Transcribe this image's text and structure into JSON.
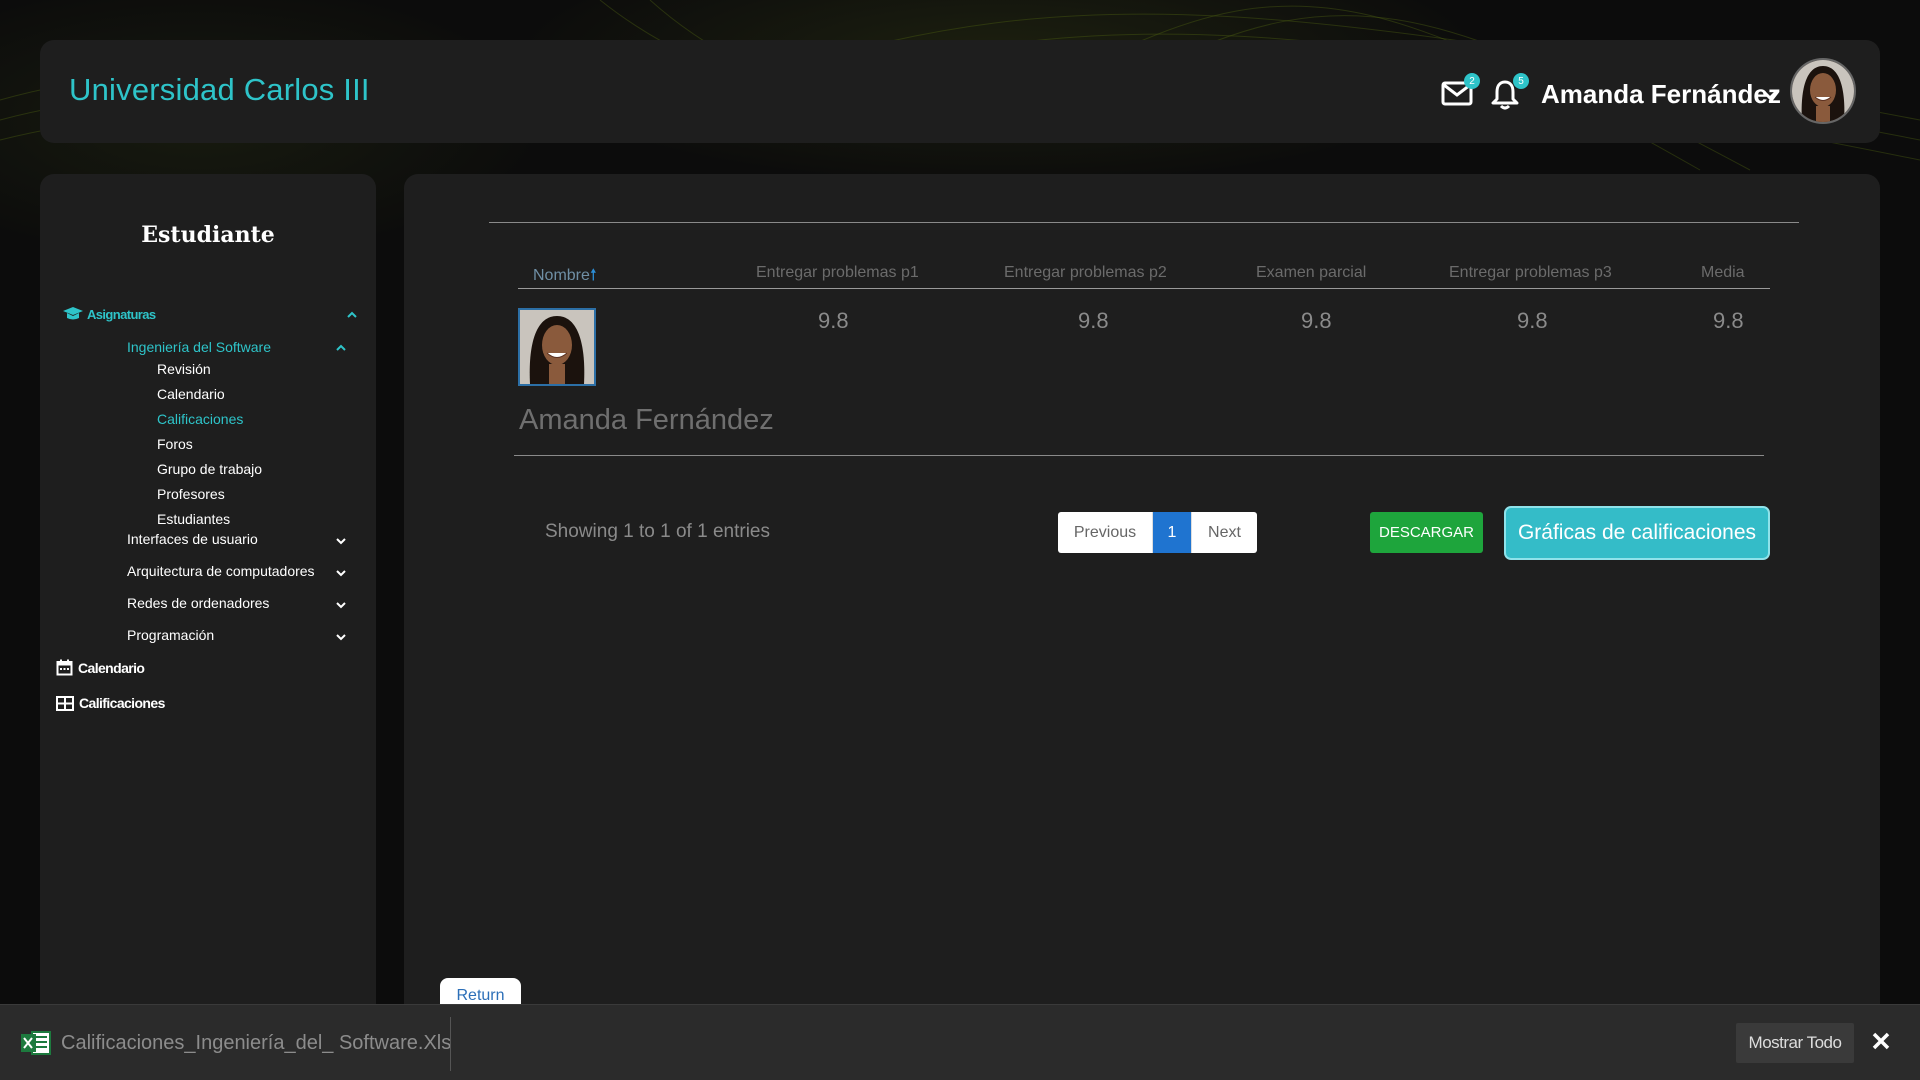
{
  "header": {
    "brand": "Universidad Carlos III",
    "mail_badge": "2",
    "bell_badge": "5",
    "user_name": "Amanda Fernández"
  },
  "sidebar": {
    "title": "Estudiante",
    "asignaturas_label": "Asignaturas",
    "course_active": "Ingeniería del Software",
    "course_sub_items": [
      "Revisión",
      "Calendario",
      "Calificaciones",
      "Foros",
      "Grupo de trabajo",
      "Profesores",
      "Estudiantes"
    ],
    "other_courses": [
      "Interfaces de usuario",
      "Arquitectura de computadores",
      "Redes de ordenadores",
      "Programación"
    ],
    "calendario_label": "Calendario",
    "calificaciones_label": "Calificaciones"
  },
  "table": {
    "columns": [
      "Nombre",
      "Entregar problemas p1",
      "Entregar problemas p2",
      "Examen parcial",
      "Entregar problemas p3",
      "Media"
    ],
    "rows": [
      {
        "name": "Amanda Fernández",
        "values": [
          "9.8",
          "9.8",
          "9.8",
          "9.8",
          "9.8"
        ]
      }
    ]
  },
  "footer": {
    "entries_text": "Showing 1 to 1 of 1 entries",
    "prev_label": "Previous",
    "page_label": "1",
    "next_label": "Next",
    "download_label": "DESCARGAR",
    "graphs_label": "Gráficas de calificaciones",
    "return_label": "Return"
  },
  "download_bar": {
    "file_name": "Calificaciones_Ingeniería_del_ Software.Xls",
    "show_all_label": "Mostrar Todo"
  },
  "colors": {
    "accent": "#2ec4c9",
    "download_green": "#1ea53c",
    "pager_active": "#1f74d0"
  }
}
